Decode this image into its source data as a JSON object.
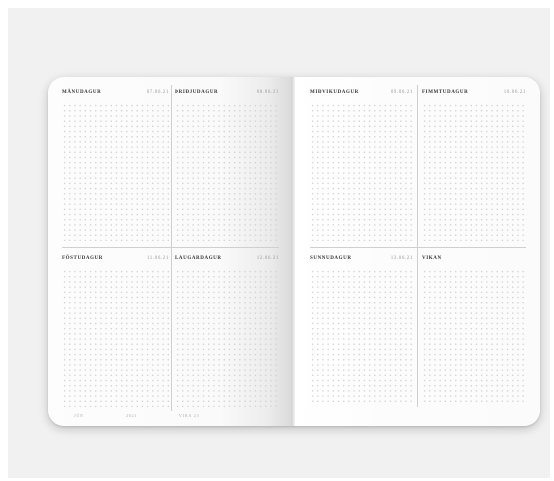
{
  "planner": {
    "days": [
      {
        "day": "MÅNUDAGUR",
        "date": "07.06.21"
      },
      {
        "day": "ÞRIÐJUDAGUR",
        "date": "08.06.21"
      },
      {
        "day": "MIÐVIKUDAGUR",
        "date": "09.06.21"
      },
      {
        "day": "FIMMTUDAGUR",
        "date": "10.06.21"
      },
      {
        "day": "FÖSTUDAGUR",
        "date": "11.06.21"
      },
      {
        "day": "LAUGARDAGUR",
        "date": "12.06.21"
      },
      {
        "day": "SUNNUDAGUR",
        "date": "13.06.21"
      },
      {
        "day": "VIKAN",
        "date": ""
      }
    ],
    "footer": [
      "JÚN",
      "2021",
      "VIKA 23"
    ]
  }
}
